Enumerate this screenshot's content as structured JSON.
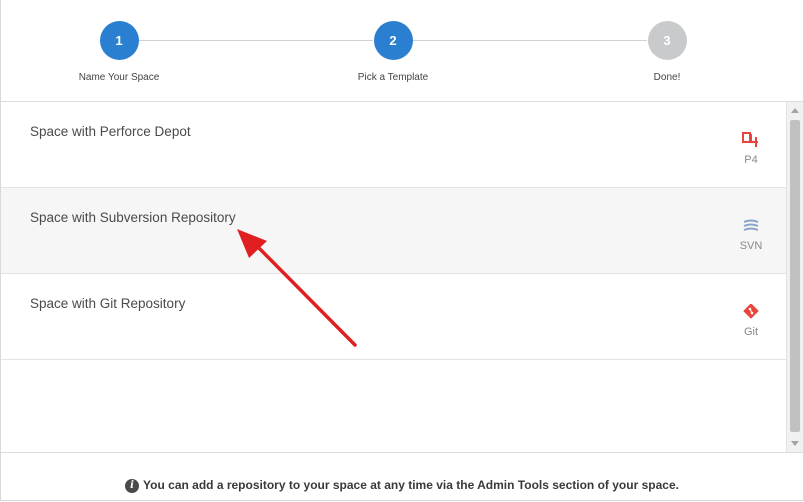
{
  "wizard": {
    "steps": [
      {
        "number": "1",
        "label": "Name Your Space",
        "state": "complete"
      },
      {
        "number": "2",
        "label": "Pick a Template",
        "state": "current"
      },
      {
        "number": "3",
        "label": "Done!",
        "state": "pending"
      }
    ]
  },
  "templates": [
    {
      "title": "Space with Perforce Depot",
      "type_label": "P4",
      "icon": "perforce-icon",
      "icon_color": "#e8453c"
    },
    {
      "title": "Space with Subversion Repository",
      "type_label": "SVN",
      "icon": "subversion-icon",
      "icon_color": "#8aa4c8"
    },
    {
      "title": "Space with Git Repository",
      "type_label": "Git",
      "icon": "git-icon",
      "icon_color": "#e8453c"
    }
  ],
  "footer": {
    "info_icon_glyph": "i",
    "note": "You can add a repository to your space at any time via the Admin Tools section of your space."
  },
  "colors": {
    "active_step": "#2b7fd0",
    "inactive_step": "#c8cacc",
    "annotation_arrow": "#e02020"
  }
}
